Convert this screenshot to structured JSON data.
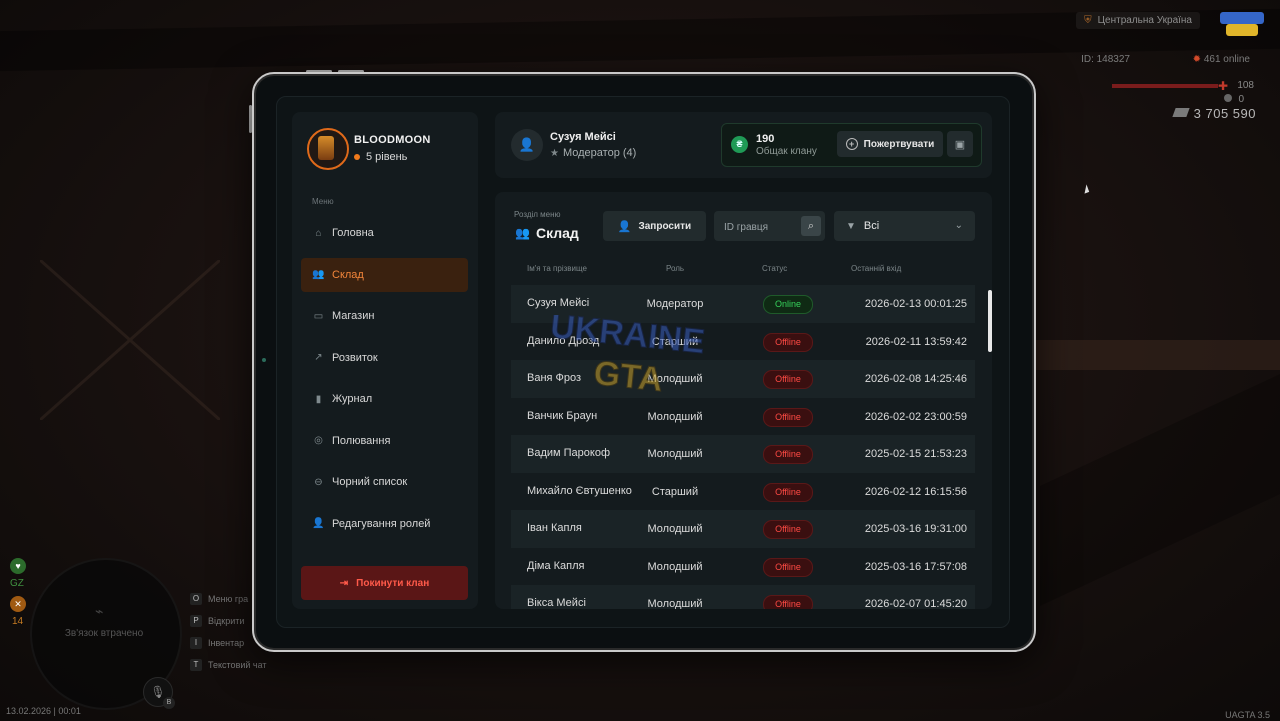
{
  "hud": {
    "server": "Центральна Україна",
    "player_id": "ID: 148327",
    "online": "461 online",
    "health": "108",
    "armor": "0",
    "money": "3 705 590",
    "gz_label": "GZ",
    "level_num": "14",
    "minimap_text": "Зв'язок втрачено",
    "hotkeys": [
      {
        "key": "O",
        "label": "Меню гра"
      },
      {
        "key": "P",
        "label": "Відкрити"
      },
      {
        "key": "I",
        "label": "Інвентар"
      },
      {
        "key": "T",
        "label": "Текстовий чат"
      }
    ],
    "mic_key": "B",
    "datetime": "13.02.2026 | 00:01",
    "version": "UAGTA 3.5"
  },
  "clan": {
    "name": "BLOODMOON",
    "level": "5 рівень"
  },
  "sidebar": {
    "caption": "Меню",
    "items": [
      {
        "label": "Головна",
        "icon": "home-icon",
        "active": false
      },
      {
        "label": "Склад",
        "icon": "users-icon",
        "active": true
      },
      {
        "label": "Магазин",
        "icon": "basket-icon",
        "active": false
      },
      {
        "label": "Розвиток",
        "icon": "chart-icon",
        "active": false
      },
      {
        "label": "Журнал",
        "icon": "book-icon",
        "active": false
      },
      {
        "label": "Полювання",
        "icon": "target-icon",
        "active": false
      },
      {
        "label": "Чорний список",
        "icon": "ban-icon",
        "active": false
      },
      {
        "label": "Редагування ролей",
        "icon": "user-edit-icon",
        "active": false
      }
    ],
    "leave_label": "Покинути клан"
  },
  "user": {
    "name": "Сузуя Мейсі",
    "role": "Модератор (4)"
  },
  "fund": {
    "value": "190",
    "label": "Общак клану",
    "donate_label": "Пожертвувати"
  },
  "section": {
    "caption": "Розділ меню",
    "title": "Склад",
    "invite_label": "Запросити",
    "search_placeholder": "ID гравця",
    "filter_value": "Всі"
  },
  "table": {
    "headers": [
      "Ім'я та прізвище",
      "Роль",
      "Статус",
      "Останній вхід"
    ],
    "rows": [
      {
        "name": "Сузуя Мейсі",
        "role": "Модератор",
        "status": "Online",
        "last": "2026-02-13 00:01:25"
      },
      {
        "name": "Данило Дрозд",
        "role": "Старший",
        "status": "Offline",
        "last": "2026-02-11 13:59:42"
      },
      {
        "name": "Ваня Фроз",
        "role": "Молодший",
        "status": "Offline",
        "last": "2026-02-08 14:25:46"
      },
      {
        "name": "Ванчик Браун",
        "role": "Молодший",
        "status": "Offline",
        "last": "2026-02-02 23:00:59"
      },
      {
        "name": "Вадим Парокоф",
        "role": "Молодший",
        "status": "Offline",
        "last": "2025-02-15 21:53:23"
      },
      {
        "name": "Михайло Євтушенко",
        "role": "Старший",
        "status": "Offline",
        "last": "2026-02-12 16:15:56"
      },
      {
        "name": "Іван Капля",
        "role": "Молодший",
        "status": "Offline",
        "last": "2025-03-16 19:31:00"
      },
      {
        "name": "Діма Капля",
        "role": "Молодший",
        "status": "Offline",
        "last": "2025-03-16 17:57:08"
      },
      {
        "name": "Вікса Мейсі",
        "role": "Молодший",
        "status": "Offline",
        "last": "2026-02-07 01:45:20"
      }
    ]
  },
  "watermark": {
    "line1": "UKRAINE",
    "line2": "GTA"
  },
  "colors": {
    "accent": "#f07a1c",
    "online": "#36d15b",
    "offline": "#ff4a44",
    "panel": "#141b1e"
  }
}
